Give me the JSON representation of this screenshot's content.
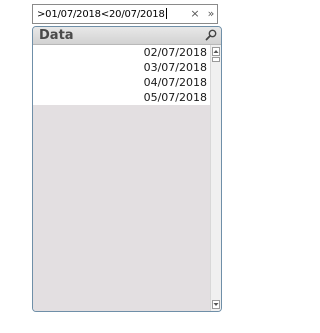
{
  "search": {
    "value": ">01/07/2018<20/07/2018",
    "clear_glyph": "×",
    "expand_glyph": "»"
  },
  "listbox": {
    "title": "Data",
    "search_icon": "search-icon",
    "items": [
      {
        "label": "02/07/2018"
      },
      {
        "label": "03/07/2018"
      },
      {
        "label": "04/07/2018"
      },
      {
        "label": "05/07/2018"
      }
    ]
  },
  "colors": {
    "header_bg": "#d9d9d9",
    "list_empty_bg": "#e3dfe1",
    "border": "#6f8fa8"
  }
}
